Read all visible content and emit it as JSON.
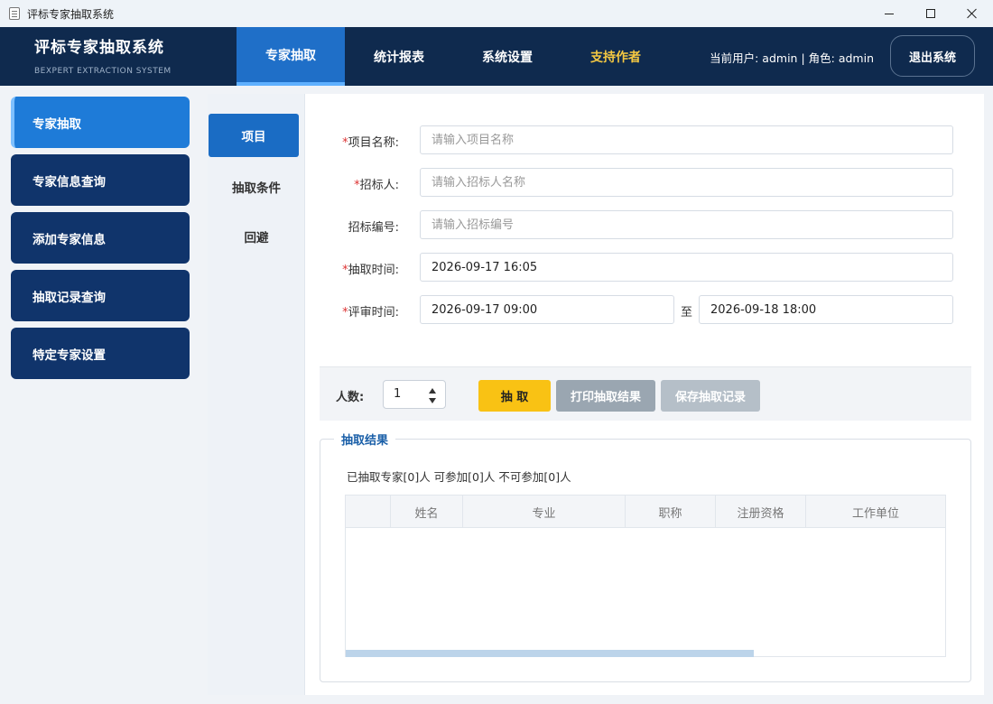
{
  "window": {
    "title": "评标专家抽取系统"
  },
  "header": {
    "brand_title": "评标专家抽取系统",
    "brand_sub": "BEXPERT EXTRACTION SYSTEM",
    "nav": [
      "专家抽取",
      "统计报表",
      "系统设置",
      "支持作者"
    ],
    "user_info": "当前用户: admin | 角色: admin",
    "logout": "退出系统"
  },
  "sidebar": {
    "items": [
      "专家抽取",
      "专家信息查询",
      "添加专家信息",
      "抽取记录查询",
      "特定专家设置"
    ]
  },
  "subnav": {
    "items": [
      "项目",
      "抽取条件",
      "回避"
    ]
  },
  "form": {
    "required_mark": "*",
    "project_name_label": "项目名称:",
    "project_name_placeholder": "请输入项目名称",
    "tenderer_label": "招标人:",
    "tenderer_placeholder": "请输入招标人名称",
    "tender_no_label": "招标编号:",
    "tender_no_placeholder": "请输入招标编号",
    "draw_time_label": "抽取时间:",
    "draw_time_value": "2026-09-17 16:05",
    "review_time_label": "评审时间:",
    "review_start": "2026-09-17 09:00",
    "range_sep": "至",
    "review_end": "2026-09-18 18:00"
  },
  "actions": {
    "count_label": "人数:",
    "count_value": "1",
    "draw": "抽 取",
    "print": "打印抽取结果",
    "save": "保存抽取记录"
  },
  "result": {
    "legend": "抽取结果",
    "summary": "已抽取专家[0]人  可参加[0]人  不可参加[0]人",
    "columns": [
      "",
      "姓名",
      "专业",
      "职称",
      "注册资格",
      "工作单位"
    ],
    "scroll_fraction": 0.68
  },
  "colors": {
    "header_bg": "#0f2a4e",
    "accent": "#1f6fc8",
    "support": "#f5c842",
    "draw_button": "#f9c214"
  }
}
